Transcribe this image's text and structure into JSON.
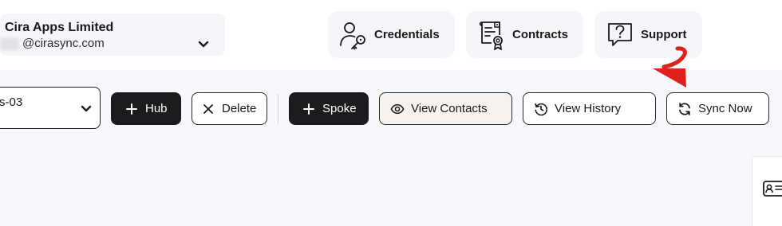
{
  "account": {
    "company": "Cira Apps Limited",
    "email": "@cirasync.com"
  },
  "top_nav": [
    {
      "label": "Credentials",
      "icon": "user-key-icon"
    },
    {
      "label": "Contracts",
      "icon": "certificate-icon"
    },
    {
      "label": "Support",
      "icon": "question-icon"
    }
  ],
  "toolbar": {
    "hub_select_value": "s-03",
    "hub_label": "Hub",
    "delete_label": "Delete",
    "spoke_label": "Spoke",
    "view_contacts_label": "View Contacts",
    "view_history_label": "View History",
    "sync_now_label": "Sync Now"
  },
  "annotation": {
    "arrow_color": "#e0201a",
    "points_to": "sync-now-button"
  },
  "colors": {
    "dark_button": "#1c1c1e",
    "page_bg": "#f7f8fc"
  }
}
